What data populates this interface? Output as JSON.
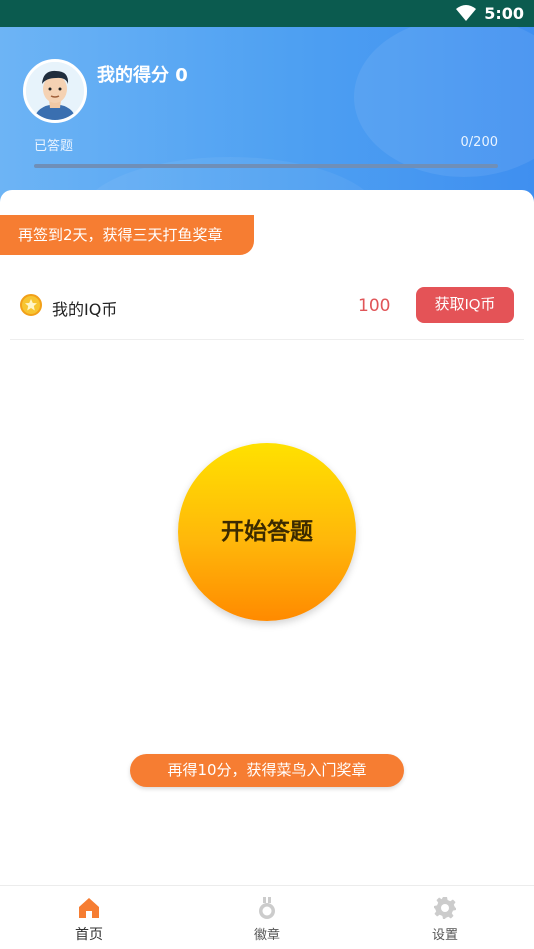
{
  "status_bar": {
    "time": "5:00",
    "wifi_icon": "wifi-icon"
  },
  "profile": {
    "avatar_icon": "avatar-cartoon-man",
    "score_title": "我的得分 0",
    "answered_label": "已答题",
    "answered_count": "0/200",
    "progress_fraction": 0
  },
  "checkin_banner": {
    "text": "再签到2天，获得三天打鱼奖章"
  },
  "iq_coin": {
    "icon": "coin-icon",
    "label": "我的IQ币",
    "value": "100",
    "button_label": "获取IQ币"
  },
  "start_button": {
    "label": "开始答题"
  },
  "badge_tip": {
    "text": "再得10分，获得菜鸟入门奖章"
  },
  "bottom_nav": {
    "items": [
      {
        "label": "首页",
        "icon": "home-icon",
        "active": true
      },
      {
        "label": "徽章",
        "icon": "medal-icon",
        "active": false
      },
      {
        "label": "设置",
        "icon": "gear-icon",
        "active": false
      }
    ]
  },
  "colors": {
    "status_bar": "#0b5b4f",
    "header_gradient_start": "#6db4f5",
    "header_gradient_end": "#3f8ff0",
    "accent_orange": "#f67d32",
    "iq_red": "#e45357",
    "start_yellow": "#ffe100",
    "start_orange": "#ff8a00"
  }
}
